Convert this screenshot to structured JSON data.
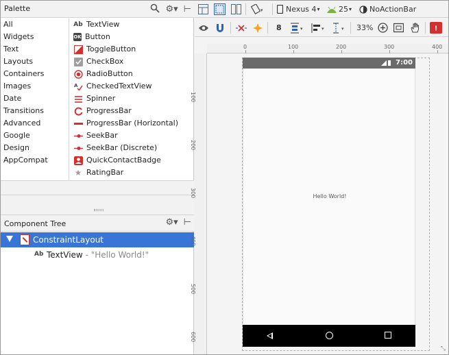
{
  "palette": {
    "title": "Palette",
    "categories": [
      "All",
      "Widgets",
      "Text",
      "Layouts",
      "Containers",
      "Images",
      "Date",
      "Transitions",
      "Advanced",
      "Google",
      "Design",
      "AppCompat"
    ],
    "items": [
      {
        "icon": "Ab",
        "label": "TextView"
      },
      {
        "icon": "OK",
        "label": "Button"
      },
      {
        "icon": "toggle",
        "label": "ToggleButton"
      },
      {
        "icon": "check",
        "label": "CheckBox"
      },
      {
        "icon": "radio",
        "label": "RadioButton"
      },
      {
        "icon": "checked-text",
        "label": "CheckedTextView"
      },
      {
        "icon": "spinner",
        "label": "Spinner"
      },
      {
        "icon": "progress",
        "label": "ProgressBar"
      },
      {
        "icon": "progress-h",
        "label": "ProgressBar (Horizontal)"
      },
      {
        "icon": "seekbar",
        "label": "SeekBar"
      },
      {
        "icon": "seekbar-d",
        "label": "SeekBar (Discrete)"
      },
      {
        "icon": "contact",
        "label": "QuickContactBadge"
      },
      {
        "icon": "star",
        "label": "RatingBar"
      }
    ]
  },
  "component_tree": {
    "title": "Component Tree",
    "root": "ConstraintLayout",
    "child_icon": "Ab",
    "child_label": "TextView",
    "child_value": " - \"Hello World!\""
  },
  "toolbar": {
    "device": "Nexus 4",
    "api": "25",
    "theme": "NoActionBar",
    "margin": "8",
    "zoom": "33%"
  },
  "rulers": {
    "top": [
      "0",
      "100",
      "200",
      "300",
      "400"
    ],
    "left": [
      "100",
      "200",
      "300",
      "400",
      "500",
      "600"
    ]
  },
  "device": {
    "time": "7:00",
    "text": "Hello World!"
  },
  "colors": {
    "selection": "#3875d7",
    "error": "#d32f2f",
    "navbar": "#000000",
    "statusbar": "#6b6b6b"
  }
}
